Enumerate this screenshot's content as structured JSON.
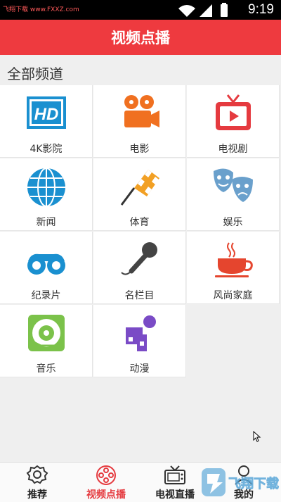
{
  "status_bar": {
    "watermark": "飞翔下载 www.FXXZ.com",
    "time": "9:19"
  },
  "header": {
    "title": "视频点播"
  },
  "section": {
    "title": "全部频道"
  },
  "channels": [
    {
      "label": "4K影院",
      "icon": "hd-icon"
    },
    {
      "label": "电影",
      "icon": "film-camera-icon"
    },
    {
      "label": "电视剧",
      "icon": "tv-icon"
    },
    {
      "label": "新闻",
      "icon": "globe-icon"
    },
    {
      "label": "体育",
      "icon": "checkered-flag-icon"
    },
    {
      "label": "娱乐",
      "icon": "theater-masks-icon"
    },
    {
      "label": "纪录片",
      "icon": "binoculars-icon"
    },
    {
      "label": "名栏目",
      "icon": "microphone-icon"
    },
    {
      "label": "风尚家庭",
      "icon": "coffee-cup-icon"
    },
    {
      "label": "音乐",
      "icon": "vinyl-record-icon"
    },
    {
      "label": "动漫",
      "icon": "cartoon-figure-icon"
    }
  ],
  "bottom_nav": [
    {
      "label": "推荐",
      "icon": "badge-icon",
      "active": false
    },
    {
      "label": "视频点播",
      "icon": "film-reel-icon",
      "active": true
    },
    {
      "label": "电视直播",
      "icon": "tv-antenna-icon",
      "active": false
    },
    {
      "label": "我的",
      "icon": "user-icon",
      "active": false
    }
  ],
  "overlay": {
    "watermark_text": "飞翔下载"
  },
  "colors": {
    "accent": "#ee3a3f",
    "icon_blue": "#1a90d0",
    "icon_orange": "#f07020"
  }
}
